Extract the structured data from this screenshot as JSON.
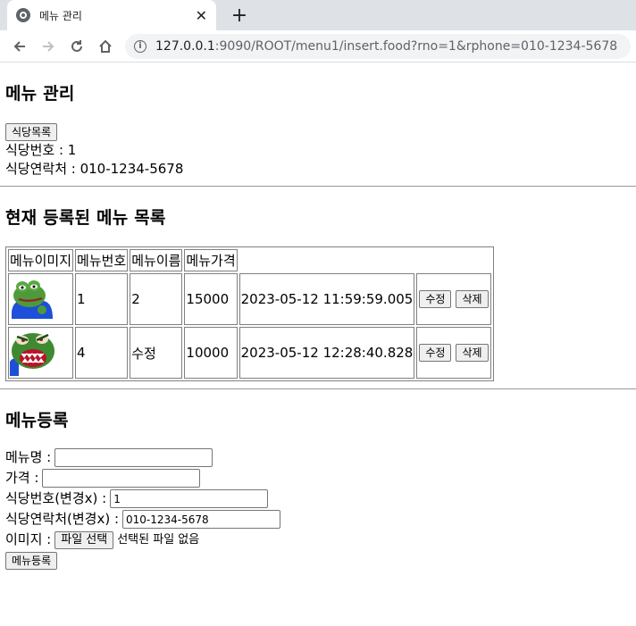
{
  "browser": {
    "tab_title": "메뉴 관리",
    "close_glyph": "✕",
    "new_tab_glyph": "+",
    "url_host": "127.0.0.1",
    "url_rest": ":9090/ROOT/menu1/insert.food?rno=1&rphone=010-1234-5678"
  },
  "page": {
    "title": "메뉴 관리",
    "list_button": "식당목록",
    "rno_line": "식당번호 : 1",
    "rphone_line": "식당연락처 : 010-1234-5678"
  },
  "menu_list": {
    "heading": "현재 등록된 메뉴 목록",
    "headers": [
      "메뉴이미지",
      "메뉴번호",
      "메뉴이름",
      "메뉴가격"
    ],
    "rows": [
      {
        "number": "1",
        "name": "2",
        "price": "15000",
        "date": "2023-05-12 11:59:59.005",
        "edit": "수정",
        "delete": "삭제"
      },
      {
        "number": "4",
        "name": "수정",
        "price": "10000",
        "date": "2023-05-12 12:28:40.828",
        "edit": "수정",
        "delete": "삭제"
      }
    ]
  },
  "form": {
    "heading": "메뉴등록",
    "name_label": "메뉴명 :",
    "name_value": "",
    "price_label": "가격 :",
    "price_value": "",
    "rno_label": "식당번호(변경x) :",
    "rno_value": "1",
    "rphone_label": "식당연락처(변경x) :",
    "rphone_value": "010-1234-5678",
    "image_label": "이미지 :",
    "file_button": "파일 선택",
    "file_status": "선택된 파일 없음",
    "submit": "메뉴등록"
  }
}
